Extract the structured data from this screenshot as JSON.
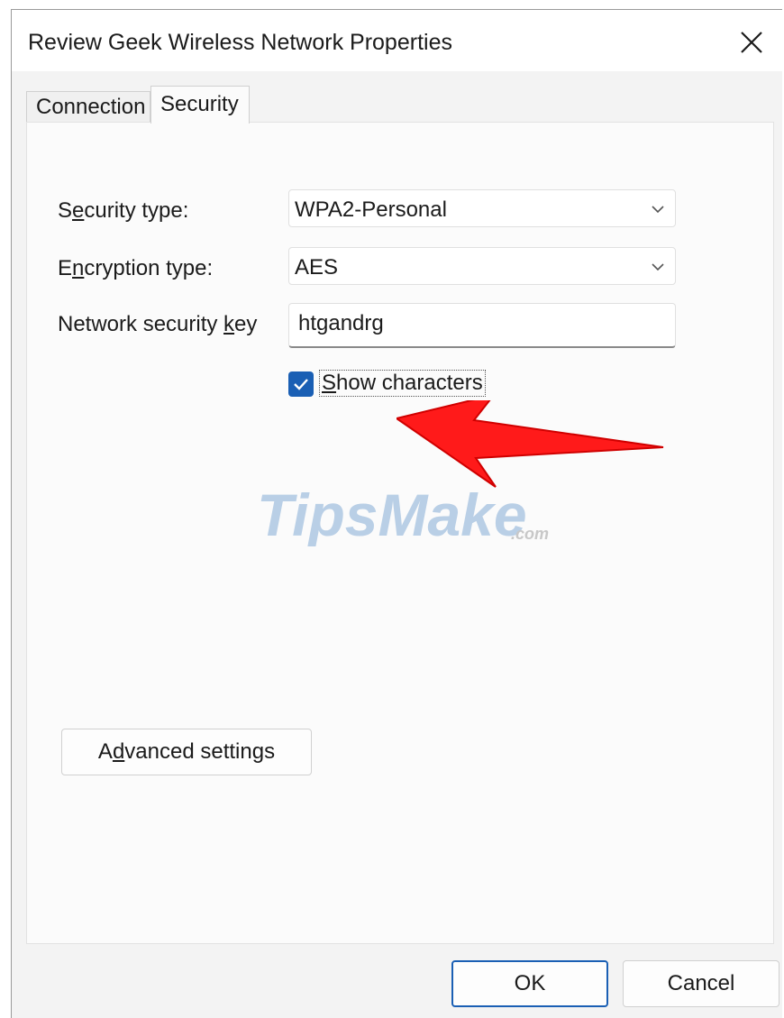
{
  "window": {
    "title": "Review Geek Wireless Network Properties"
  },
  "tabs": [
    {
      "label": "Connection",
      "active": false
    },
    {
      "label": "Security",
      "active": true
    }
  ],
  "form": {
    "security_type": {
      "label_pre": "S",
      "label_u": "e",
      "label_post": "curity type:",
      "value": "WPA2-Personal"
    },
    "encryption_type": {
      "label_pre": "E",
      "label_u": "n",
      "label_post": "cryption type:",
      "value": "AES"
    },
    "network_key": {
      "label_pre": "Network security ",
      "label_u": "k",
      "label_post": "ey",
      "value": "htgandrg"
    },
    "show_characters": {
      "label_u": "S",
      "label_post": "how characters",
      "checked": true
    }
  },
  "watermark": {
    "main": "TipsMake",
    "suffix": ".com"
  },
  "buttons": {
    "advanced_pre": "A",
    "advanced_u": "d",
    "advanced_post": "vanced settings",
    "ok": "OK",
    "cancel": "Cancel"
  },
  "colors": {
    "accent": "#1a5fb4",
    "arrow": "#ff1a1a",
    "panel": "#fbfbfb",
    "window": "#f3f3f3"
  }
}
